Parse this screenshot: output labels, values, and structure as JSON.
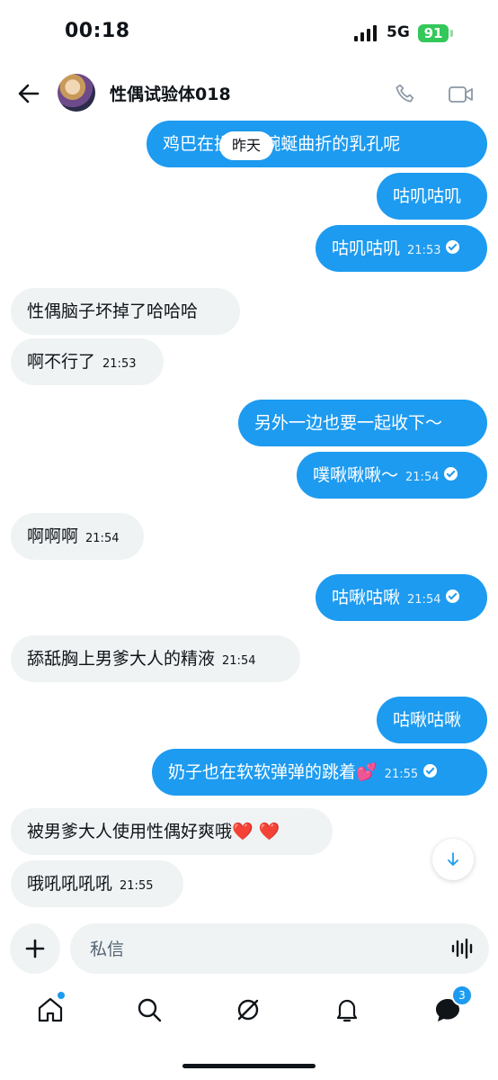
{
  "status": {
    "time": "00:18",
    "network": "5G",
    "battery": "91"
  },
  "header": {
    "title": "性偶试验体018"
  },
  "day_label": "昨天",
  "messages": [
    {
      "dir": "out",
      "text": "鸡巴在操018蜿蜒曲折的乳孔呢",
      "time": ""
    },
    {
      "dir": "out",
      "text": "咕叽咕叽",
      "time": ""
    },
    {
      "dir": "out",
      "text": "咕叽咕叽",
      "time": "21:53"
    },
    {
      "dir": "in",
      "text": "性偶脑子坏掉了哈哈哈",
      "time": ""
    },
    {
      "dir": "in",
      "text": "啊不行了",
      "time": "21:53"
    },
    {
      "dir": "out",
      "text": "另外一边也要一起收下～",
      "time": ""
    },
    {
      "dir": "out",
      "text": "噗啾啾啾～",
      "time": "21:54"
    },
    {
      "dir": "in",
      "text": "啊啊啊",
      "time": "21:54"
    },
    {
      "dir": "out",
      "text": "咕啾咕啾",
      "time": "21:54"
    },
    {
      "dir": "in",
      "text": "舔舐胸上男爹大人的精液",
      "time": "21:54"
    },
    {
      "dir": "out",
      "text": "咕啾咕啾",
      "time": ""
    },
    {
      "dir": "out",
      "text": "奶子也在软软弹弹的跳着💕",
      "time": "21:55"
    },
    {
      "dir": "in",
      "text": "被男爹大人使用性偶好爽哦",
      "emoji": "❤️ ❤️",
      "time": ""
    },
    {
      "dir": "in",
      "text": "哦吼吼吼吼",
      "time": "21:55"
    }
  ],
  "composer": {
    "placeholder": "私信"
  },
  "tabs": {
    "messages_badge": "3"
  },
  "colors": {
    "accent": "#1d9bf0",
    "incoming": "#eff3f4"
  }
}
